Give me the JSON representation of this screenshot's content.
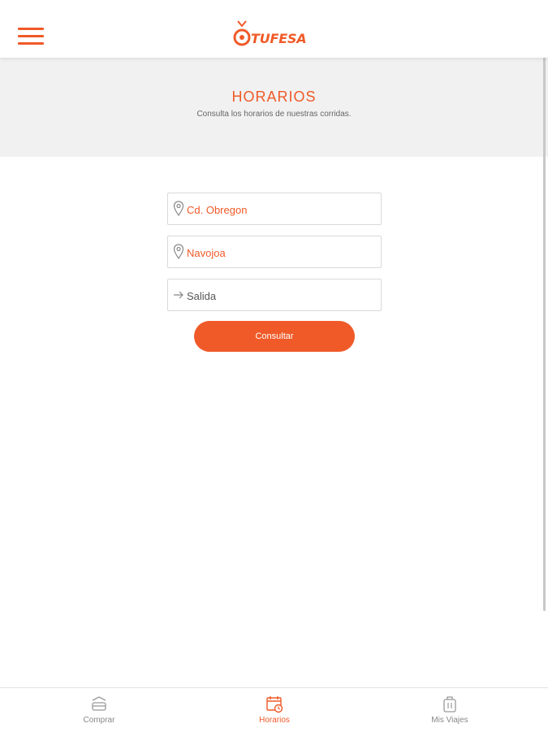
{
  "header": {
    "brand": "TUFESA",
    "menu_icon": "hamburger-menu-icon"
  },
  "hero": {
    "title": "HORARIOS",
    "subtitle": "Consulta los horarios de nuestras corridas."
  },
  "form": {
    "origin": {
      "value": "Cd. Obregon",
      "icon": "location-pin-icon"
    },
    "destination": {
      "value": "Navojoa",
      "icon": "location-pin-icon"
    },
    "departure": {
      "placeholder": "Salida",
      "icon": "arrow-right-icon"
    },
    "submit_label": "Consultar"
  },
  "bottom_nav": {
    "items": [
      {
        "label": "Comprar",
        "icon": "bus-ticket-icon",
        "active": false
      },
      {
        "label": "Horarios",
        "icon": "calendar-clock-icon",
        "active": true
      },
      {
        "label": "Mis Viajes",
        "icon": "luggage-icon",
        "active": false
      }
    ]
  },
  "colors": {
    "accent": "#f05a28",
    "hero_bg": "#f1f1f2",
    "muted_text": "#888888"
  }
}
